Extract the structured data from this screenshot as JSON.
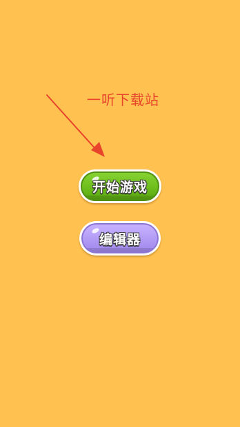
{
  "watermark": {
    "text": "一听下载站",
    "color": "#E8442B"
  },
  "annotation": {
    "arrow_icon": "arrow-down-right",
    "color": "#E8442B"
  },
  "menu": {
    "start_button": {
      "label": "开始游戏",
      "color": "#6DBE1C"
    },
    "editor_button": {
      "label": "编辑器",
      "color": "#B19BF5"
    }
  },
  "background_color": "#FFC150"
}
